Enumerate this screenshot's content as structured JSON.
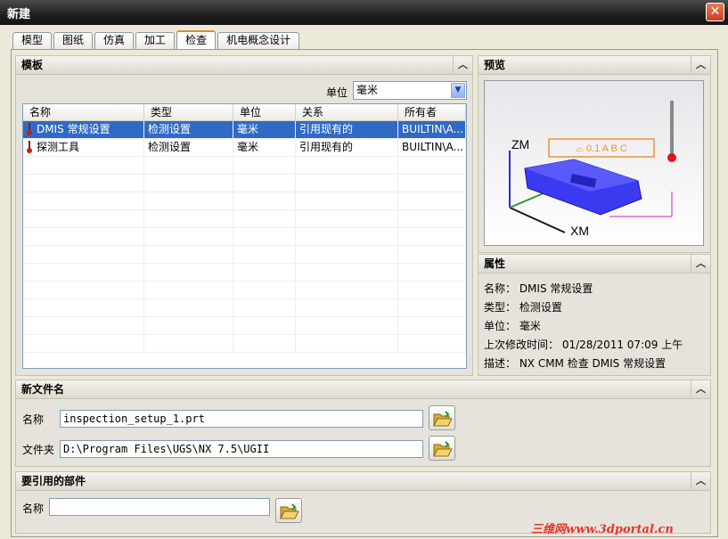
{
  "window": {
    "title": "新建",
    "close_glyph": "✕"
  },
  "tabs": [
    {
      "label": "模型"
    },
    {
      "label": "图纸"
    },
    {
      "label": "仿真"
    },
    {
      "label": "加工"
    },
    {
      "label": "检查",
      "active": true
    },
    {
      "label": "机电概念设计"
    }
  ],
  "template_panel": {
    "title": "模板",
    "unit_label": "单位",
    "unit_value": "毫米",
    "columns": [
      "名称",
      "类型",
      "单位",
      "关系",
      "所有者"
    ],
    "rows": [
      {
        "name": "DMIS 常规设置",
        "type": "检测设置",
        "unit": "毫米",
        "relation": "引用现有的",
        "owner": "BUILTIN\\A...",
        "selected": true
      },
      {
        "name": "探测工具",
        "type": "检测设置",
        "unit": "毫米",
        "relation": "引用现有的",
        "owner": "BUILTIN\\A...",
        "selected": false
      }
    ]
  },
  "preview_panel": {
    "title": "预览",
    "label_zm": "ZM",
    "label_xm": "XM",
    "gdt_label": "⌓ 0.1 A B C"
  },
  "properties_panel": {
    "title": "属性",
    "name": "名称： DMIS 常规设置",
    "type": "类型： 检测设置",
    "unit": "单位： 毫米",
    "modified": "上次修改时间： 01/28/2011 07:09 上午",
    "description": "描述： NX CMM 检查 DMIS 常规设置"
  },
  "new_file_panel": {
    "title": "新文件名",
    "name_label": "名称",
    "name_value": "inspection_setup_1.prt",
    "folder_label": "文件夹",
    "folder_value": "D:\\Program Files\\UGS\\NX 7.5\\UGII"
  },
  "reference_panel": {
    "title": "要引用的部件",
    "name_label": "名称",
    "name_value": ""
  },
  "icons": {
    "collapse": "chevron-up-icon",
    "folder": "open-folder-icon",
    "select": "dropdown-arrow-icon"
  },
  "watermark": "三维网www.3dportal.cn",
  "colors": {
    "selection": "#316ac5",
    "tab_accent": "#e68b2c",
    "model_blue": "#3a3af0",
    "indicator_red": "#e0141a"
  }
}
